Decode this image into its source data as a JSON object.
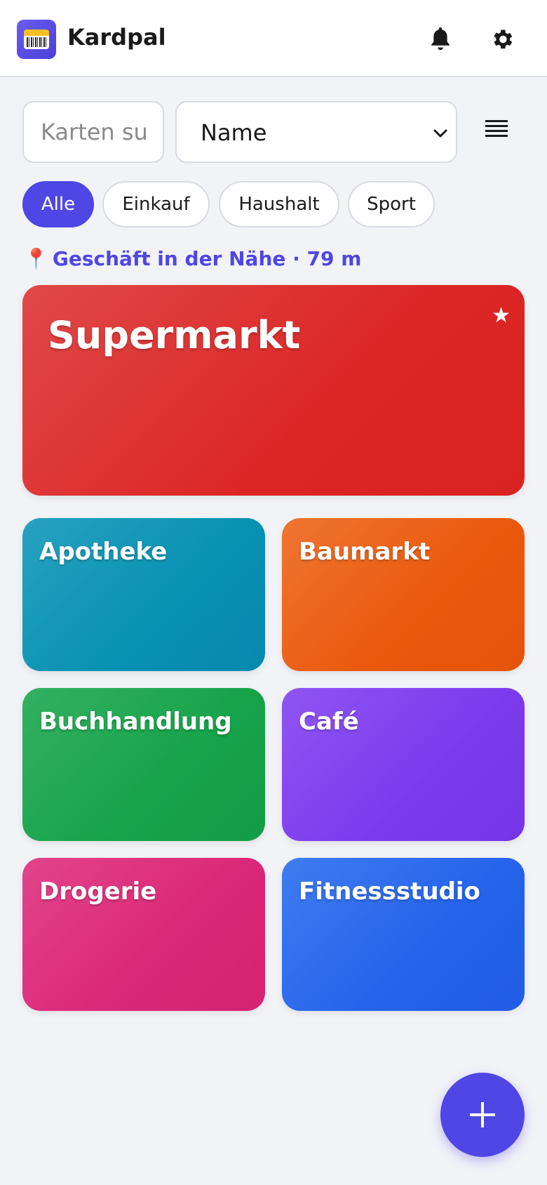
{
  "app": {
    "title": "Kardpal"
  },
  "header": {
    "notifications_icon": "bell-icon",
    "settings_icon": "gear-icon"
  },
  "search": {
    "placeholder": "Karten suchen",
    "value": ""
  },
  "sort": {
    "selected": "Name"
  },
  "view_toggle_icon": "list-view-icon",
  "filters": [
    {
      "label": "Alle",
      "active": true
    },
    {
      "label": "Einkauf",
      "active": false
    },
    {
      "label": "Haushalt",
      "active": false
    },
    {
      "label": "Sport",
      "active": false
    }
  ],
  "nearby": {
    "icon": "pin-icon",
    "text": "Geschäft in der Nähe · 79 m"
  },
  "featured_card": {
    "name": "Supermarkt",
    "favorite": true,
    "color": "#dc2626"
  },
  "cards": [
    {
      "name": "Apotheke",
      "color": "#0891b2"
    },
    {
      "name": "Baumarkt",
      "color": "#ea580c"
    },
    {
      "name": "Buchhandlung",
      "color": "#16a34a"
    },
    {
      "name": "Café",
      "color": "#7c3aed"
    },
    {
      "name": "Drogerie",
      "color": "#db2777"
    },
    {
      "name": "Fitnessstudio",
      "color": "#2563eb"
    }
  ],
  "fab": {
    "icon": "plus-icon"
  },
  "accent": "#4f46e5"
}
